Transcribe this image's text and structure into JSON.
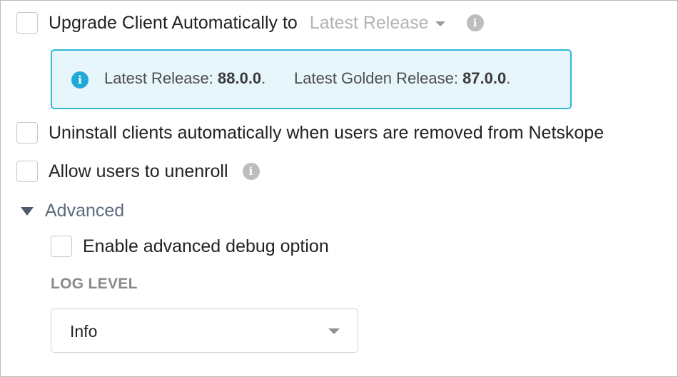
{
  "upgrade": {
    "label": "Upgrade Client Automatically to",
    "selected": "Latest Release",
    "icon": "info-icon"
  },
  "release_banner": {
    "icon": "info-circle-icon",
    "latest_label": "Latest Release:",
    "latest_value": "88.0.0",
    "golden_label": "Latest Golden Release:",
    "golden_value": "87.0.0",
    "period": "."
  },
  "uninstall": {
    "label": "Uninstall clients automatically when users are removed from Netskope"
  },
  "unenroll": {
    "label": "Allow users to unenroll",
    "icon": "info-icon"
  },
  "advanced": {
    "label": "Advanced",
    "icon": "disclosure-triangle-down-icon",
    "debug_label": "Enable advanced debug option",
    "log_level_label": "LOG LEVEL",
    "log_level_value": "Info"
  },
  "colors": {
    "banner_bg": "#e6f6fb",
    "banner_border": "#34b8d8",
    "banner_icon": "#23a9d6",
    "info_icon": "#bdbdbd",
    "advanced_text": "#5b6b7b"
  }
}
